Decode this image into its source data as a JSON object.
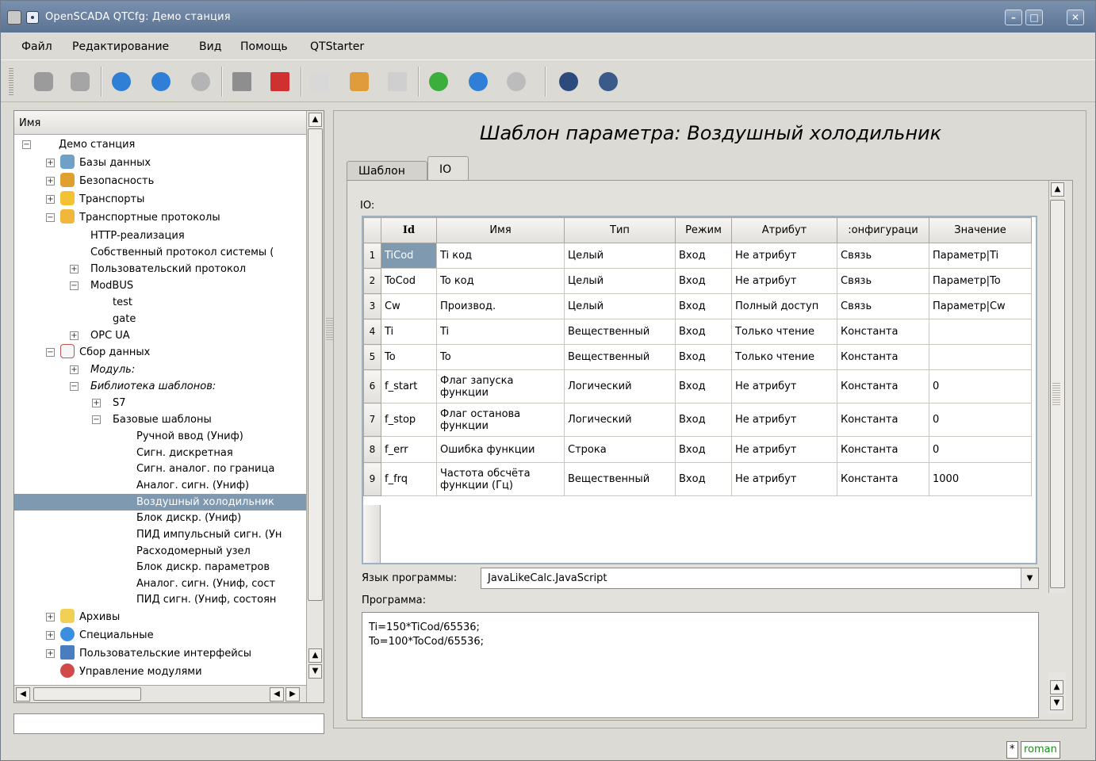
{
  "window": {
    "title": "OpenSCADA QTCfg: Демо станция",
    "minimize": "–",
    "maximize": "□",
    "close": "✕"
  },
  "menu": [
    {
      "label": "Файл"
    },
    {
      "label": "Редактирование"
    },
    {
      "label": "Вид"
    },
    {
      "label": "Помощь"
    },
    {
      "label": "QTStarter"
    }
  ],
  "toolbar": [
    "db-load-icon",
    "db-save-icon",
    "up-icon",
    "back-icon",
    "forward-icon",
    "add-item-icon",
    "delete-item-icon",
    "copy-icon",
    "cut-icon",
    "paste-icon",
    "refresh-icon",
    "start-icon",
    "stop-icon",
    "qtstarter-icon",
    "cfg-icon"
  ],
  "tree": {
    "header": "Имя",
    "items": [
      {
        "label": "Демо станция"
      },
      {
        "label": "Базы данных"
      },
      {
        "label": "Безопасность"
      },
      {
        "label": "Транспорты"
      },
      {
        "label": "Транспортные протоколы"
      },
      {
        "label": "HTTP-реализация"
      },
      {
        "label": "Собственный протокол системы ("
      },
      {
        "label": "Пользовательский протокол"
      },
      {
        "label": "ModBUS"
      },
      {
        "label": "test"
      },
      {
        "label": "gate"
      },
      {
        "label": "OPC UA"
      },
      {
        "label": "Сбор данных"
      },
      {
        "label": "Модуль:"
      },
      {
        "label": "Библиотека шаблонов:"
      },
      {
        "label": "S7"
      },
      {
        "label": "Базовые шаблоны"
      },
      {
        "label": "Ручной ввод (Униф)"
      },
      {
        "label": "Сигн. дискретная"
      },
      {
        "label": "Сигн. аналог. по граница"
      },
      {
        "label": "Аналог. сигн. (Униф)"
      },
      {
        "label": "Воздушный холодильник"
      },
      {
        "label": "Блок дискр. (Униф)"
      },
      {
        "label": "ПИД импульсный сигн. (Ун"
      },
      {
        "label": "Расходомерный узел"
      },
      {
        "label": "Блок дискр. параметров"
      },
      {
        "label": "Аналог. сигн. (Униф, сост"
      },
      {
        "label": "ПИД сигн. (Униф, состоян"
      },
      {
        "label": "Архивы"
      },
      {
        "label": "Специальные"
      },
      {
        "label": "Пользовательские интерфейсы"
      },
      {
        "label": "Управление модулями"
      }
    ]
  },
  "main": {
    "title": "Шаблон параметра: Воздушный холодильник",
    "tabs": [
      {
        "label": "Шаблон"
      },
      {
        "label": "IO"
      }
    ],
    "io_label": "IO:",
    "table": {
      "headers": [
        "Id",
        "Имя",
        "Тип",
        "Режим",
        "Атрибут",
        ":онфигураци",
        "Значение"
      ],
      "rows": [
        {
          "n": "1",
          "id": "TiCod",
          "name": "Ti код",
          "type": "Целый",
          "mode": "Вход",
          "attr": "Не атрибут",
          "cfg": "Связь",
          "value": "Параметр|Ti"
        },
        {
          "n": "2",
          "id": "ToCod",
          "name": "To код",
          "type": "Целый",
          "mode": "Вход",
          "attr": "Не атрибут",
          "cfg": "Связь",
          "value": "Параметр|To"
        },
        {
          "n": "3",
          "id": "Cw",
          "name": "Производ.",
          "type": "Целый",
          "mode": "Вход",
          "attr": "Полный доступ",
          "cfg": "Связь",
          "value": "Параметр|Cw"
        },
        {
          "n": "4",
          "id": "Ti",
          "name": "Ti",
          "type": "Вещественный",
          "mode": "Вход",
          "attr": "Только чтение",
          "cfg": "Константа",
          "value": ""
        },
        {
          "n": "5",
          "id": "To",
          "name": "To",
          "type": "Вещественный",
          "mode": "Вход",
          "attr": "Только чтение",
          "cfg": "Константа",
          "value": ""
        },
        {
          "n": "6",
          "id": "f_start",
          "name": "Флаг запуска функции",
          "type": "Логический",
          "mode": "Вход",
          "attr": "Не атрибут",
          "cfg": "Константа",
          "value": "0"
        },
        {
          "n": "7",
          "id": "f_stop",
          "name": "Флаг останова функции",
          "type": "Логический",
          "mode": "Вход",
          "attr": "Не атрибут",
          "cfg": "Константа",
          "value": "0"
        },
        {
          "n": "8",
          "id": "f_err",
          "name": "Ошибка функции",
          "type": "Строка",
          "mode": "Вход",
          "attr": "Не атрибут",
          "cfg": "Константа",
          "value": "0"
        },
        {
          "n": "9",
          "id": "f_frq",
          "name": "Частота обсчёта функции (Гц)",
          "type": "Вещественный",
          "mode": "Вход",
          "attr": "Не атрибут",
          "cfg": "Константа",
          "value": "1000"
        }
      ]
    },
    "lang_label": "Язык программы:",
    "lang_value": "JavaLikeCalc.JavaScript",
    "program_label": "Программа:",
    "program": "Ti=150*TiCod/65536;\nTo=100*ToCod/65536;"
  },
  "status": {
    "modified": "*",
    "user": "roman"
  }
}
